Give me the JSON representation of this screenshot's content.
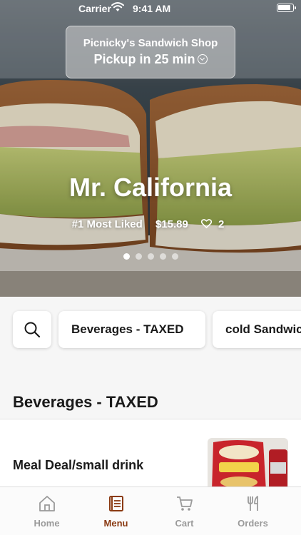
{
  "status_bar": {
    "carrier": "Carrier",
    "time": "9:41 AM"
  },
  "store": {
    "name": "Picnicky's Sandwich Shop",
    "pickup": "Pickup in 25 min"
  },
  "featured": {
    "title": "Mr. California",
    "badge": "#1 Most Liked",
    "price": "$15.89",
    "likes": "2",
    "slide_count": 5,
    "active_slide": 1
  },
  "categories": {
    "search_icon": "search-icon",
    "chips": [
      "Beverages - TAXED",
      "cold Sandwiches"
    ]
  },
  "section": {
    "title": "Beverages - TAXED"
  },
  "items": [
    {
      "name": "Meal Deal/small drink"
    }
  ],
  "tabs": [
    {
      "label": "Home",
      "icon": "home-icon",
      "active": false
    },
    {
      "label": "Menu",
      "icon": "menu-icon",
      "active": true
    },
    {
      "label": "Cart",
      "icon": "cart-icon",
      "active": false
    },
    {
      "label": "Orders",
      "icon": "fork-knife-icon",
      "active": false
    }
  ],
  "colors": {
    "accent": "#8a3a12",
    "inactive": "#9a9a9a",
    "background": "#f6f6f6"
  }
}
